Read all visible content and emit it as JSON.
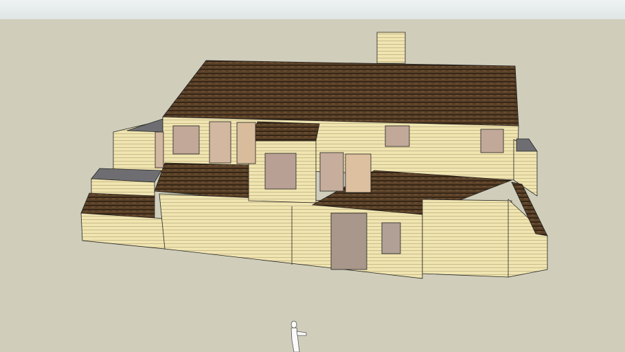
{
  "colors": {
    "sky": "#e6ecec",
    "ground": "#d0cebb",
    "siding": "#f0e4b0",
    "siding_line": "#b9ac7c",
    "roof": "#4a3520",
    "roof_line": "#2a1c10",
    "gray_roof": "#6e6e72",
    "window": "#c2a898",
    "door": "#a8978a"
  }
}
